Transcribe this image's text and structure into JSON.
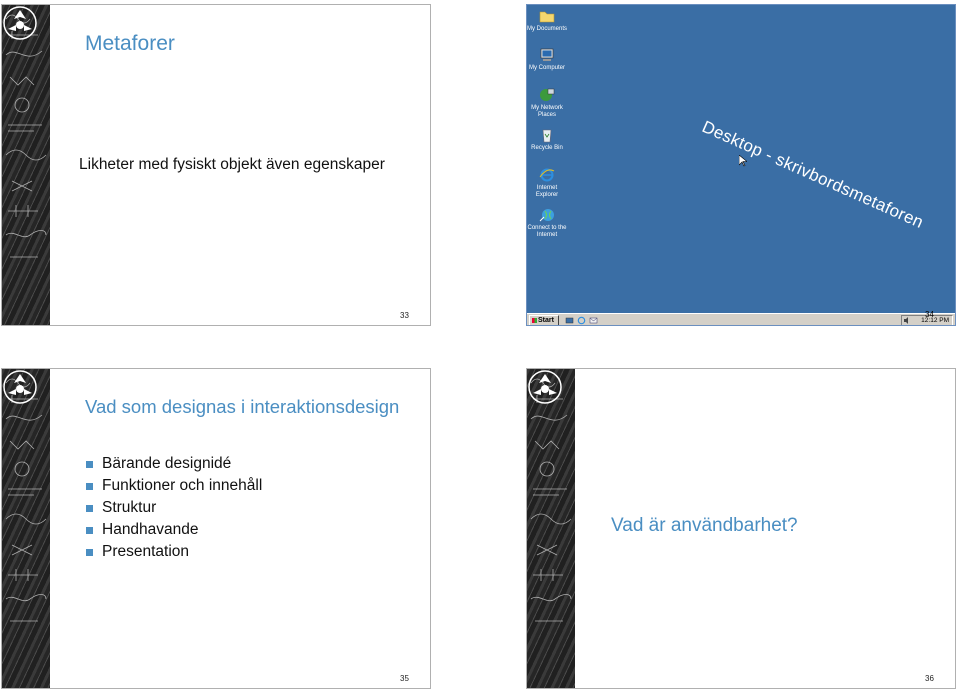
{
  "slides": [
    {
      "number": "33",
      "title": "Metaforer",
      "body": "Likheter med fysiskt objekt även egenskaper"
    },
    {
      "number": "34",
      "desktop_icons": [
        {
          "label": "My Documents",
          "icon": "folder-icon"
        },
        {
          "label": "My Computer",
          "icon": "computer-icon"
        },
        {
          "label": "My Network Places",
          "icon": "network-icon"
        },
        {
          "label": "Recycle Bin",
          "icon": "recycle-bin-icon"
        },
        {
          "label": "Internet Explorer",
          "icon": "internet-explorer-icon"
        },
        {
          "label": "Connect to the Internet",
          "icon": "connect-icon"
        }
      ],
      "caption": "Desktop - skrivbordsmetaforen",
      "taskbar": {
        "start": "Start",
        "clock": "12:12 PM"
      },
      "desktop_color": "#3a6ea5"
    },
    {
      "number": "35",
      "title": "Vad som designas i interaktionsdesign",
      "bullets": [
        "Bärande designidé",
        "Funktioner och innehåll",
        "Struktur",
        "Handhavande",
        "Presentation"
      ]
    },
    {
      "number": "36",
      "body": "Vad är användbarhet?"
    }
  ],
  "accent_color": "#4a8ec2"
}
